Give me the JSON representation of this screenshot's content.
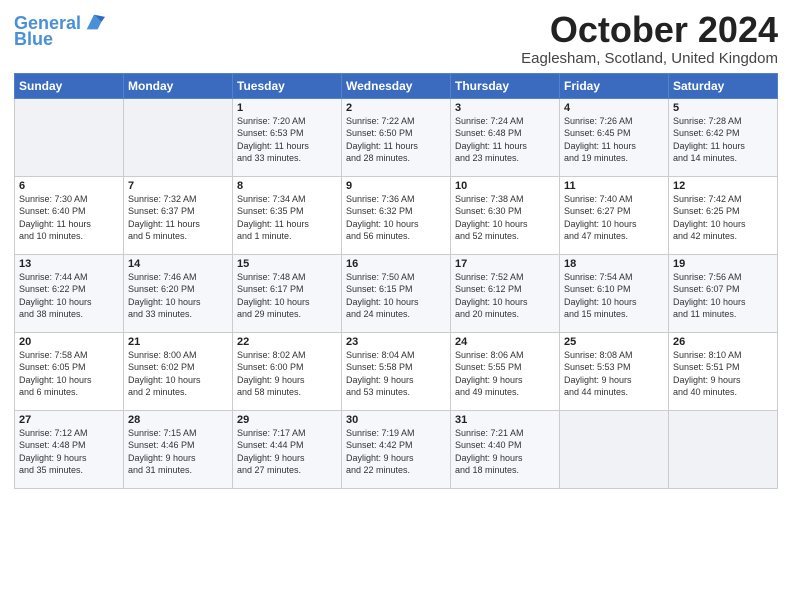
{
  "header": {
    "logo_line1": "General",
    "logo_line2": "Blue",
    "month_title": "October 2024",
    "subtitle": "Eaglesham, Scotland, United Kingdom"
  },
  "weekdays": [
    "Sunday",
    "Monday",
    "Tuesday",
    "Wednesday",
    "Thursday",
    "Friday",
    "Saturday"
  ],
  "weeks": [
    [
      {
        "day": "",
        "info": ""
      },
      {
        "day": "",
        "info": ""
      },
      {
        "day": "1",
        "info": "Sunrise: 7:20 AM\nSunset: 6:53 PM\nDaylight: 11 hours\nand 33 minutes."
      },
      {
        "day": "2",
        "info": "Sunrise: 7:22 AM\nSunset: 6:50 PM\nDaylight: 11 hours\nand 28 minutes."
      },
      {
        "day": "3",
        "info": "Sunrise: 7:24 AM\nSunset: 6:48 PM\nDaylight: 11 hours\nand 23 minutes."
      },
      {
        "day": "4",
        "info": "Sunrise: 7:26 AM\nSunset: 6:45 PM\nDaylight: 11 hours\nand 19 minutes."
      },
      {
        "day": "5",
        "info": "Sunrise: 7:28 AM\nSunset: 6:42 PM\nDaylight: 11 hours\nand 14 minutes."
      }
    ],
    [
      {
        "day": "6",
        "info": "Sunrise: 7:30 AM\nSunset: 6:40 PM\nDaylight: 11 hours\nand 10 minutes."
      },
      {
        "day": "7",
        "info": "Sunrise: 7:32 AM\nSunset: 6:37 PM\nDaylight: 11 hours\nand 5 minutes."
      },
      {
        "day": "8",
        "info": "Sunrise: 7:34 AM\nSunset: 6:35 PM\nDaylight: 11 hours\nand 1 minute."
      },
      {
        "day": "9",
        "info": "Sunrise: 7:36 AM\nSunset: 6:32 PM\nDaylight: 10 hours\nand 56 minutes."
      },
      {
        "day": "10",
        "info": "Sunrise: 7:38 AM\nSunset: 6:30 PM\nDaylight: 10 hours\nand 52 minutes."
      },
      {
        "day": "11",
        "info": "Sunrise: 7:40 AM\nSunset: 6:27 PM\nDaylight: 10 hours\nand 47 minutes."
      },
      {
        "day": "12",
        "info": "Sunrise: 7:42 AM\nSunset: 6:25 PM\nDaylight: 10 hours\nand 42 minutes."
      }
    ],
    [
      {
        "day": "13",
        "info": "Sunrise: 7:44 AM\nSunset: 6:22 PM\nDaylight: 10 hours\nand 38 minutes."
      },
      {
        "day": "14",
        "info": "Sunrise: 7:46 AM\nSunset: 6:20 PM\nDaylight: 10 hours\nand 33 minutes."
      },
      {
        "day": "15",
        "info": "Sunrise: 7:48 AM\nSunset: 6:17 PM\nDaylight: 10 hours\nand 29 minutes."
      },
      {
        "day": "16",
        "info": "Sunrise: 7:50 AM\nSunset: 6:15 PM\nDaylight: 10 hours\nand 24 minutes."
      },
      {
        "day": "17",
        "info": "Sunrise: 7:52 AM\nSunset: 6:12 PM\nDaylight: 10 hours\nand 20 minutes."
      },
      {
        "day": "18",
        "info": "Sunrise: 7:54 AM\nSunset: 6:10 PM\nDaylight: 10 hours\nand 15 minutes."
      },
      {
        "day": "19",
        "info": "Sunrise: 7:56 AM\nSunset: 6:07 PM\nDaylight: 10 hours\nand 11 minutes."
      }
    ],
    [
      {
        "day": "20",
        "info": "Sunrise: 7:58 AM\nSunset: 6:05 PM\nDaylight: 10 hours\nand 6 minutes."
      },
      {
        "day": "21",
        "info": "Sunrise: 8:00 AM\nSunset: 6:02 PM\nDaylight: 10 hours\nand 2 minutes."
      },
      {
        "day": "22",
        "info": "Sunrise: 8:02 AM\nSunset: 6:00 PM\nDaylight: 9 hours\nand 58 minutes."
      },
      {
        "day": "23",
        "info": "Sunrise: 8:04 AM\nSunset: 5:58 PM\nDaylight: 9 hours\nand 53 minutes."
      },
      {
        "day": "24",
        "info": "Sunrise: 8:06 AM\nSunset: 5:55 PM\nDaylight: 9 hours\nand 49 minutes."
      },
      {
        "day": "25",
        "info": "Sunrise: 8:08 AM\nSunset: 5:53 PM\nDaylight: 9 hours\nand 44 minutes."
      },
      {
        "day": "26",
        "info": "Sunrise: 8:10 AM\nSunset: 5:51 PM\nDaylight: 9 hours\nand 40 minutes."
      }
    ],
    [
      {
        "day": "27",
        "info": "Sunrise: 7:12 AM\nSunset: 4:48 PM\nDaylight: 9 hours\nand 35 minutes."
      },
      {
        "day": "28",
        "info": "Sunrise: 7:15 AM\nSunset: 4:46 PM\nDaylight: 9 hours\nand 31 minutes."
      },
      {
        "day": "29",
        "info": "Sunrise: 7:17 AM\nSunset: 4:44 PM\nDaylight: 9 hours\nand 27 minutes."
      },
      {
        "day": "30",
        "info": "Sunrise: 7:19 AM\nSunset: 4:42 PM\nDaylight: 9 hours\nand 22 minutes."
      },
      {
        "day": "31",
        "info": "Sunrise: 7:21 AM\nSunset: 4:40 PM\nDaylight: 9 hours\nand 18 minutes."
      },
      {
        "day": "",
        "info": ""
      },
      {
        "day": "",
        "info": ""
      }
    ]
  ]
}
